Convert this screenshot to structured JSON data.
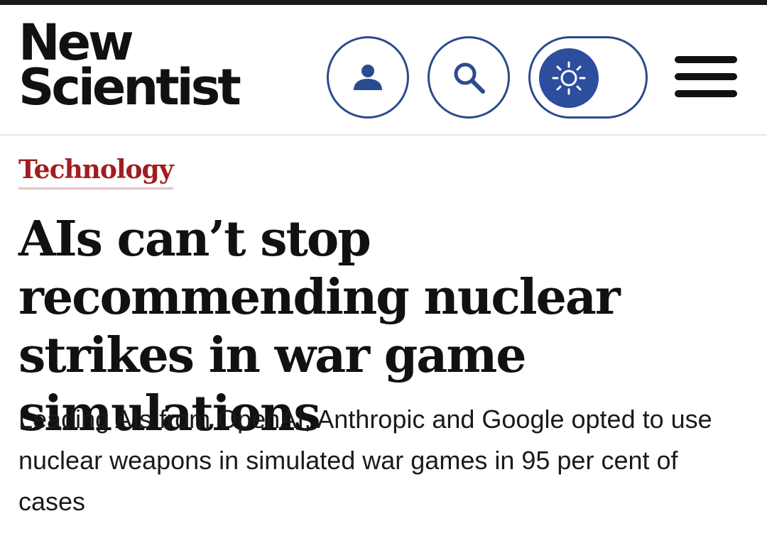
{
  "logo": {
    "line1": "New",
    "line2": "Scientist"
  },
  "header": {
    "icons": [
      "user-icon",
      "search-icon",
      "sun-icon",
      "menu-icon"
    ]
  },
  "colors": {
    "accent_blue": "#2b4b8f",
    "toggle_fill": "#2d4d9d",
    "category_red": "#a11d21",
    "text": "#111111"
  },
  "article": {
    "category": "Technology",
    "headline": "AIs can’t stop recommending nuclear strikes in war game simulations",
    "standfirst": "Leading AIs from OpenAI, Anthropic and Google opted to use nuclear weapons in simulated war games in 95 per cent of cases"
  }
}
